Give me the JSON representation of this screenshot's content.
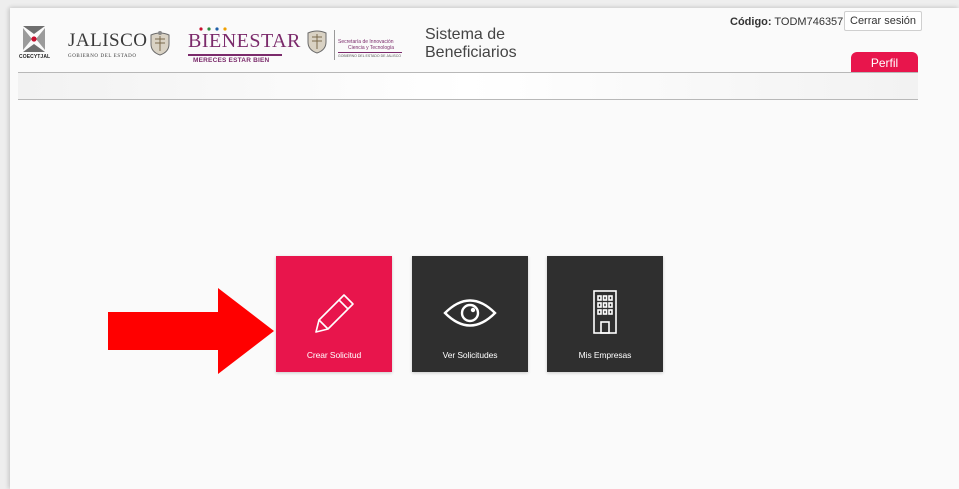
{
  "header": {
    "logos": {
      "coecytjal": "COECYTJAL",
      "jalisco": {
        "name": "JALISCO",
        "sub": "GOBIERNO DEL ESTADO"
      },
      "bienestar": {
        "name": "BIENESTAR",
        "sub": "MERECES ESTAR BIEN"
      },
      "secretaria": {
        "line1": "Secretaría de Innovación",
        "line2": "Ciencia y Tecnología",
        "line3": "GOBIERNO DEL ESTADO DE JALISCO"
      }
    },
    "app_title_line1": "Sistema de",
    "app_title_line2": "Beneficiarios",
    "codigo_label": "Código:",
    "codigo_value": "TODM746357",
    "logout_label": "Cerrar sesión",
    "profile_tab_label": "Perfil"
  },
  "tiles": [
    {
      "label": "Crear Solicitud",
      "icon": "pencil-icon",
      "color": "#e8154c"
    },
    {
      "label": "Ver Solicitudes",
      "icon": "eye-icon",
      "color": "#2f2f2f"
    },
    {
      "label": "Mis Empresas",
      "icon": "building-icon",
      "color": "#2f2f2f"
    }
  ],
  "annotation": {
    "icon": "arrow-right-icon",
    "color": "#ff0000"
  }
}
